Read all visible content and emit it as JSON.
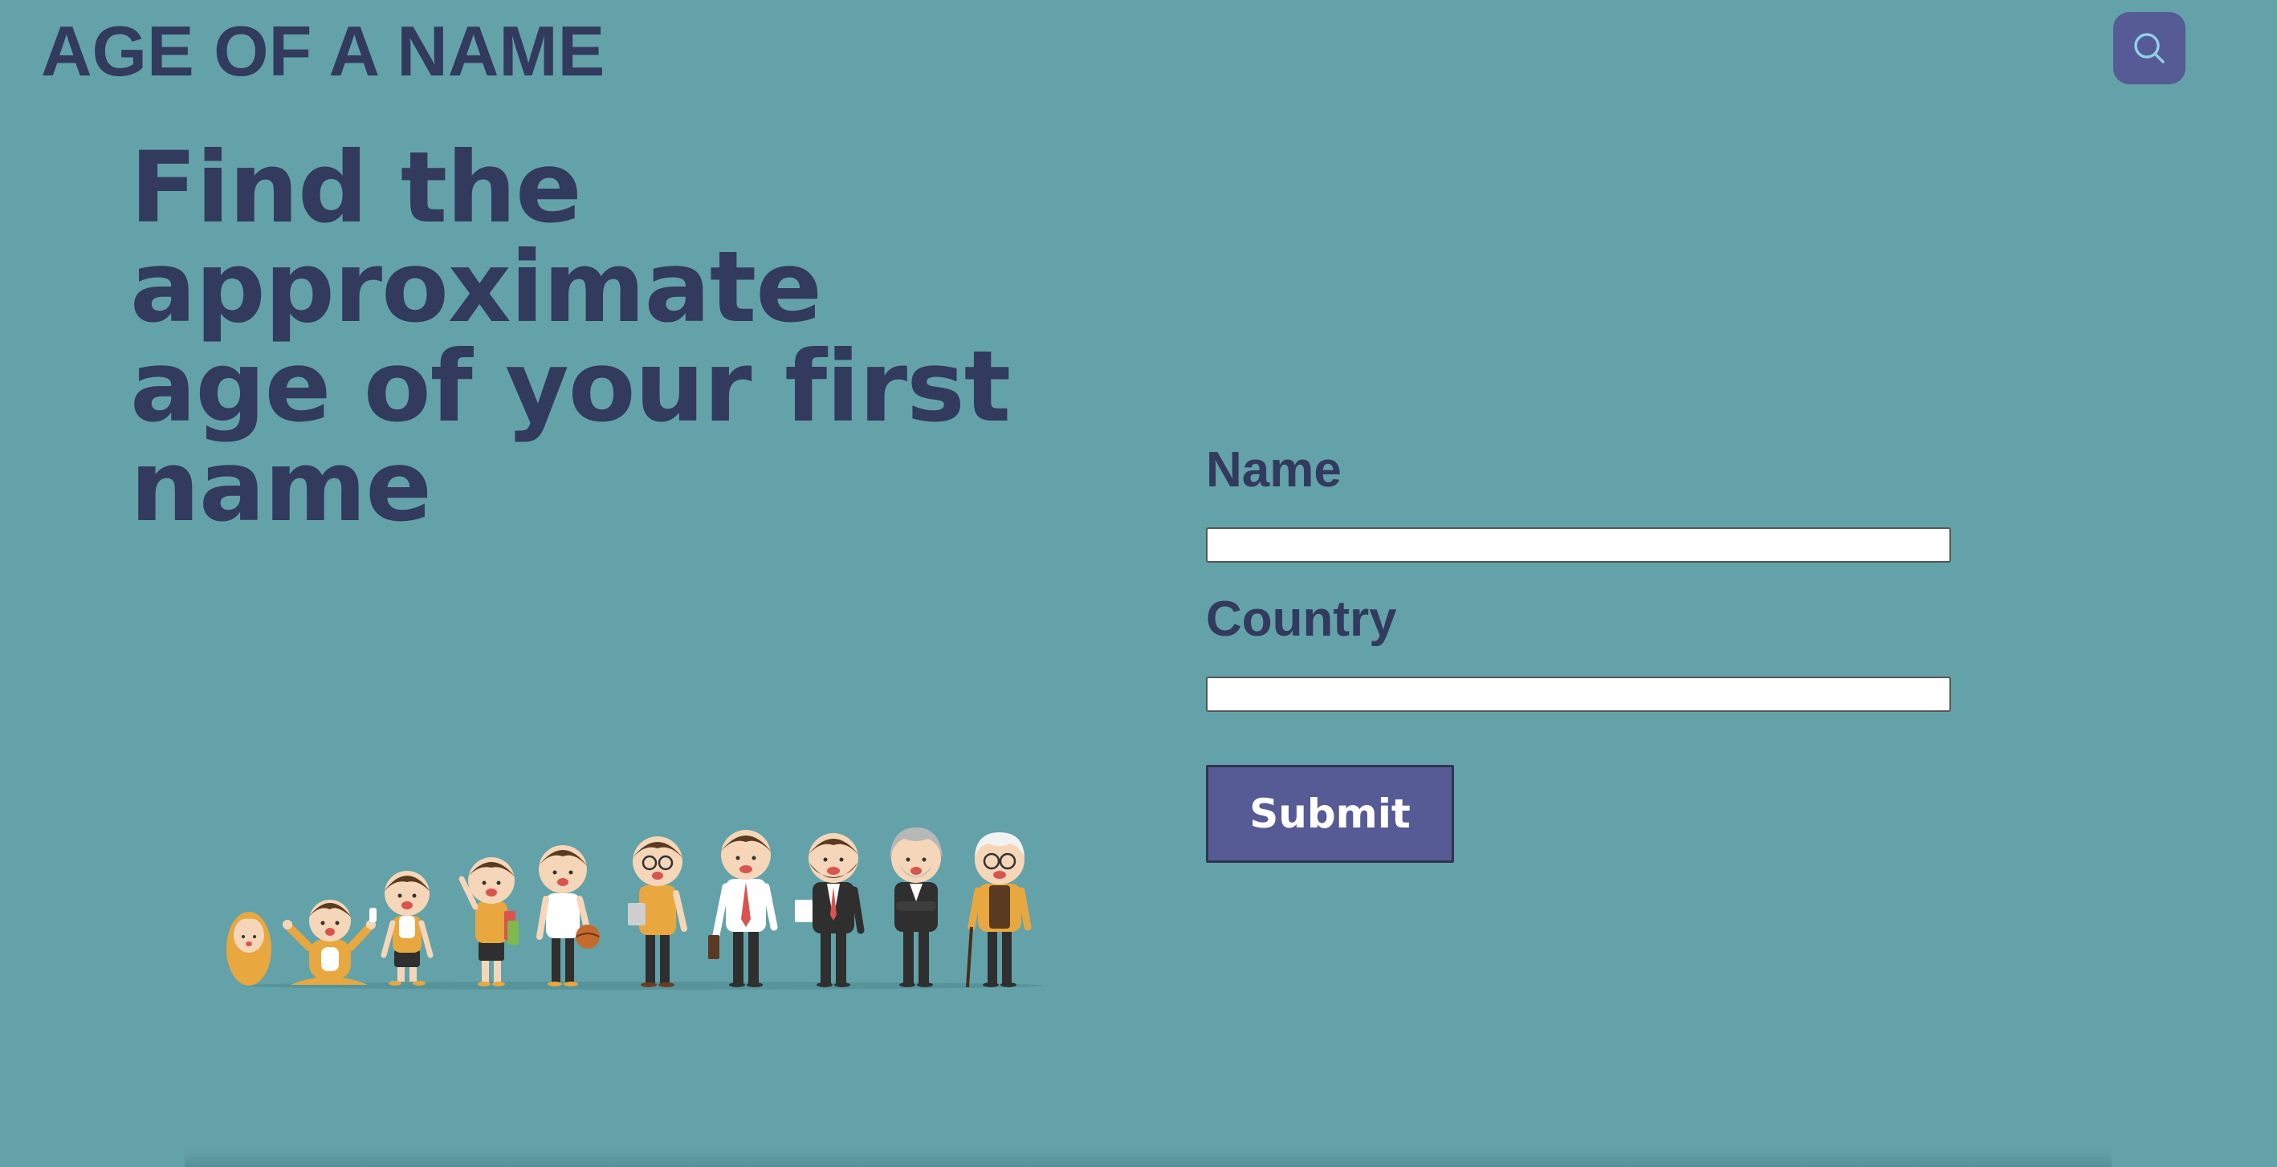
{
  "header": {
    "site_title": "AGE OF A NAME",
    "search_icon": "search-icon"
  },
  "hero": {
    "headline_lines": [
      "Find the",
      "approximate",
      "age of your first",
      "name"
    ]
  },
  "form": {
    "name_label": "Name",
    "name_value": "",
    "country_label": "Country",
    "country_value": "",
    "submit_label": "Submit"
  },
  "illustration": {
    "subject": "people-of-different-ages"
  },
  "colors": {
    "background": "#64a2a9",
    "text": "#323a5e",
    "accent": "#565a95"
  }
}
